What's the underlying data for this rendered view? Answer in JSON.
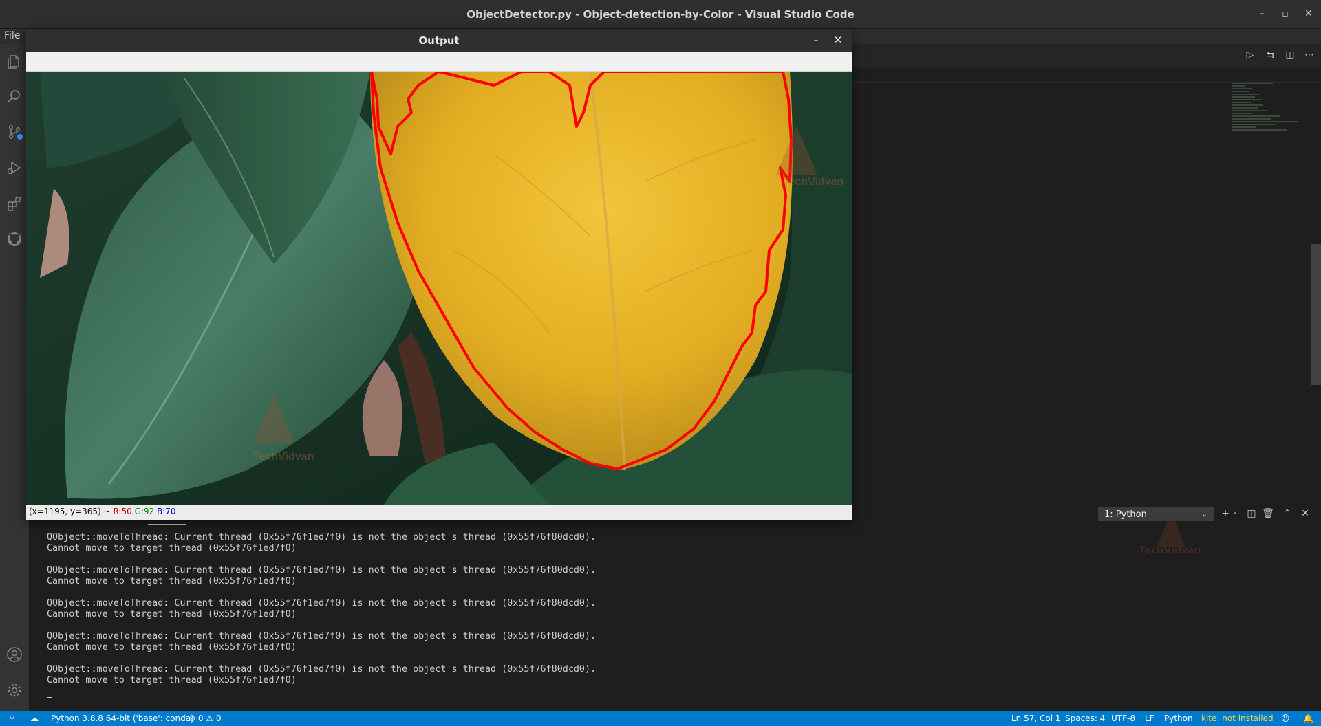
{
  "os_window": {
    "title": "ObjectDetector.py - Object-detection-by-Color - Visual Studio Code",
    "minimize": "–",
    "maximize": "▫",
    "close": "✕"
  },
  "menu": {
    "file": "File"
  },
  "output_window": {
    "title": "Output",
    "minimize": "–",
    "close": "✕",
    "status": {
      "coords": "(x=1195, y=365) ~",
      "r": "R:50",
      "g": "G:92",
      "b": "B:70"
    },
    "watermark": "TechVidvan"
  },
  "terminal": {
    "selector": "1: Python",
    "lines": [
      "QObject::moveToThread: Current thread (0x55f76f1ed7f0) is not the object's thread (0x55f76f80dcd0).\nCannot move to target thread (0x55f76f1ed7f0)",
      "QObject::moveToThread: Current thread (0x55f76f1ed7f0) is not the object's thread (0x55f76f80dcd0).\nCannot move to target thread (0x55f76f1ed7f0)",
      "QObject::moveToThread: Current thread (0x55f76f1ed7f0) is not the object's thread (0x55f76f80dcd0).\nCannot move to target thread (0x55f76f1ed7f0)",
      "QObject::moveToThread: Current thread (0x55f76f1ed7f0) is not the object's thread (0x55f76f80dcd0).\nCannot move to target thread (0x55f76f1ed7f0)",
      "QObject::moveToThread: Current thread (0x55f76f1ed7f0) is not the object's thread (0x55f76f80dcd0).\nCannot move to target thread (0x55f76f1ed7f0)"
    ],
    "watermark": "TechVidvan"
  },
  "statusbar": {
    "interpreter": "Python 3.8.8 64-bit ('base': conda)",
    "problems": "⊗ 0 ⚠ 0",
    "position": "Ln 57, Col 1",
    "spaces": "Spaces: 4",
    "encoding": "UTF-8",
    "eol": "LF",
    "language": "Python",
    "kite": "kite: not installed"
  },
  "colors": {
    "statusbar": "#007acc",
    "contour": "#ff0000",
    "leaf_yellow": "#e6b62a",
    "leaf_green": "#2f5e45"
  }
}
